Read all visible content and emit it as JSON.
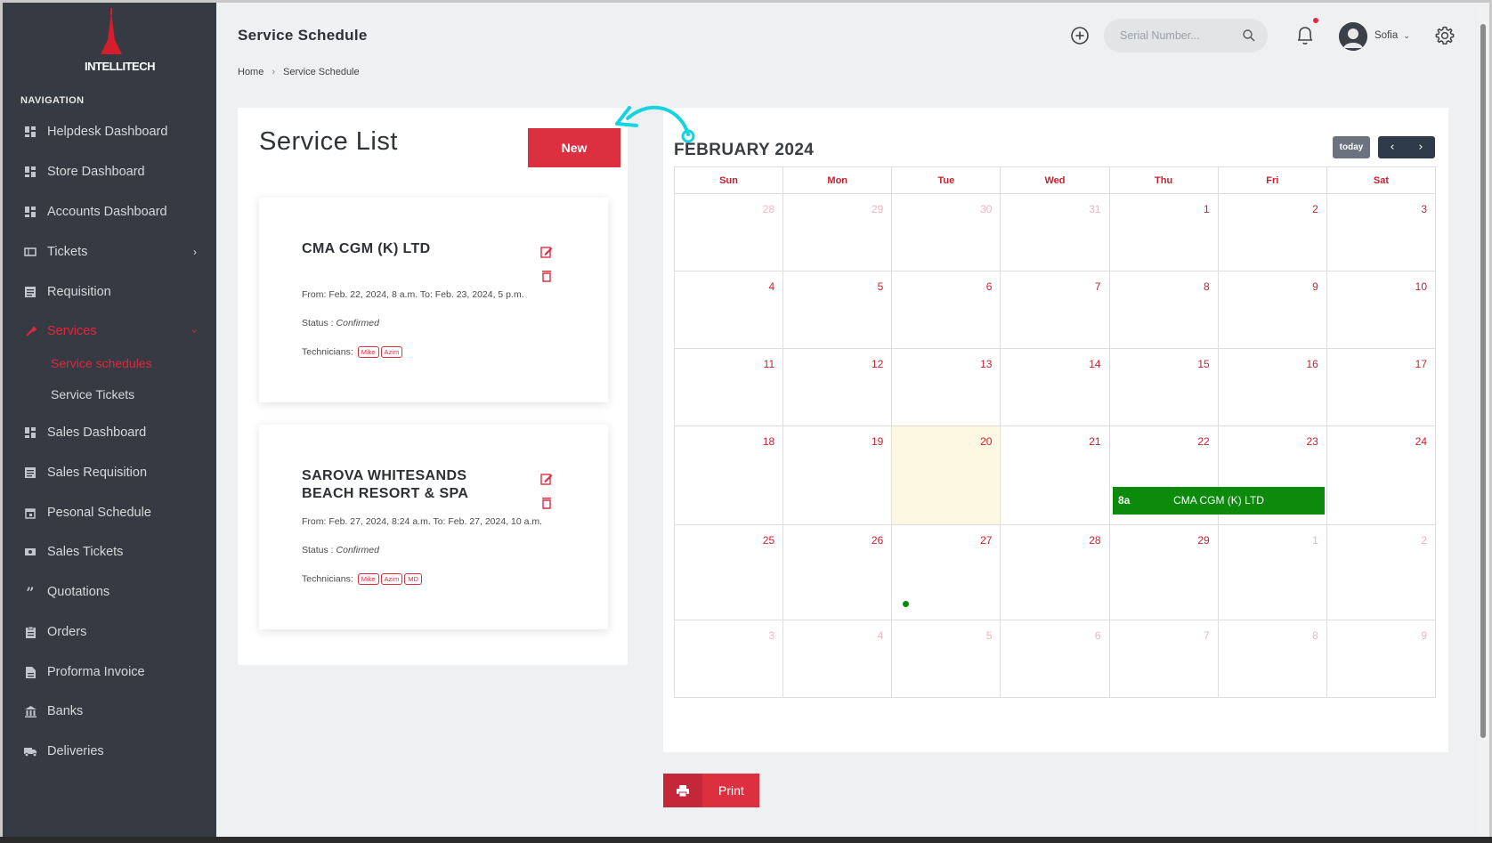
{
  "brand": {
    "logo_text": "INTELLITECH"
  },
  "sidebar": {
    "heading": "NAVIGATION",
    "items": [
      {
        "label": "Helpdesk Dashboard",
        "icon": "dashboard-icon"
      },
      {
        "label": "Store Dashboard",
        "icon": "dashboard-icon"
      },
      {
        "label": "Accounts Dashboard",
        "icon": "dashboard-icon"
      },
      {
        "label": "Tickets",
        "icon": "ticket-icon"
      },
      {
        "label": "Requisition",
        "icon": "list-icon"
      },
      {
        "label": "Services",
        "icon": "wrench-icon"
      },
      {
        "label": "Sales Dashboard",
        "icon": "dashboard-icon"
      },
      {
        "label": "Sales Requisition",
        "icon": "list-icon"
      },
      {
        "label": "Pesonal Schedule",
        "icon": "calendar-icon"
      },
      {
        "label": "Sales Tickets",
        "icon": "ticket-icon"
      },
      {
        "label": "Quotations",
        "icon": "quote-icon"
      },
      {
        "label": "Orders",
        "icon": "clipboard-icon"
      },
      {
        "label": "Proforma Invoice",
        "icon": "document-icon"
      },
      {
        "label": "Banks",
        "icon": "bank-icon"
      },
      {
        "label": "Deliveries",
        "icon": "truck-icon"
      }
    ],
    "services_sub": [
      {
        "label": "Service schedules"
      },
      {
        "label": "Service Tickets"
      }
    ]
  },
  "header": {
    "title": "Service Schedule",
    "breadcrumb": [
      "Home",
      "Service Schedule"
    ],
    "search_placeholder": "Serial Number...",
    "username": "Sofia"
  },
  "service_list": {
    "title": "Service List",
    "new_label": "New",
    "cards": [
      {
        "name": "CMA CGM (K) LTD",
        "dates": "From: Feb. 22, 2024, 8 a.m. To: Feb. 23, 2024, 5 p.m.",
        "status_label": "Status : ",
        "status": "Confirmed",
        "technicians_label": "Technicians:",
        "technicians": [
          "Mike",
          "Azim"
        ]
      },
      {
        "name": "SAROVA WHITESANDS BEACH RESORT & SPA",
        "dates": "From: Feb. 27, 2024, 8:24 a.m. To: Feb. 27, 2024, 10 a.m.",
        "status_label": "Status : ",
        "status": "Confirmed",
        "technicians_label": "Technicians:",
        "technicians": [
          "Mike",
          "Azim",
          "MD"
        ]
      }
    ]
  },
  "calendar": {
    "title": "FEBRUARY 2024",
    "today_label": "today",
    "weekdays": [
      "Sun",
      "Mon",
      "Tue",
      "Wed",
      "Thu",
      "Fri",
      "Sat"
    ],
    "weeks": [
      [
        "28",
        "29",
        "30",
        "31",
        "1",
        "2",
        "3"
      ],
      [
        "4",
        "5",
        "6",
        "7",
        "8",
        "9",
        "10"
      ],
      [
        "11",
        "12",
        "13",
        "14",
        "15",
        "16",
        "17"
      ],
      [
        "18",
        "19",
        "20",
        "21",
        "22",
        "23",
        "24"
      ],
      [
        "25",
        "26",
        "27",
        "28",
        "29",
        "1",
        "2"
      ],
      [
        "3",
        "4",
        "5",
        "6",
        "7",
        "8",
        "9"
      ]
    ],
    "today": "20",
    "events": [
      {
        "time": "8a",
        "title": "CMA CGM (K) LTD"
      }
    ],
    "colors": {
      "accent": "#dc2f40",
      "event": "#0b8a0b",
      "today_bg": "#fdf8e2"
    }
  },
  "print_label": "Print"
}
